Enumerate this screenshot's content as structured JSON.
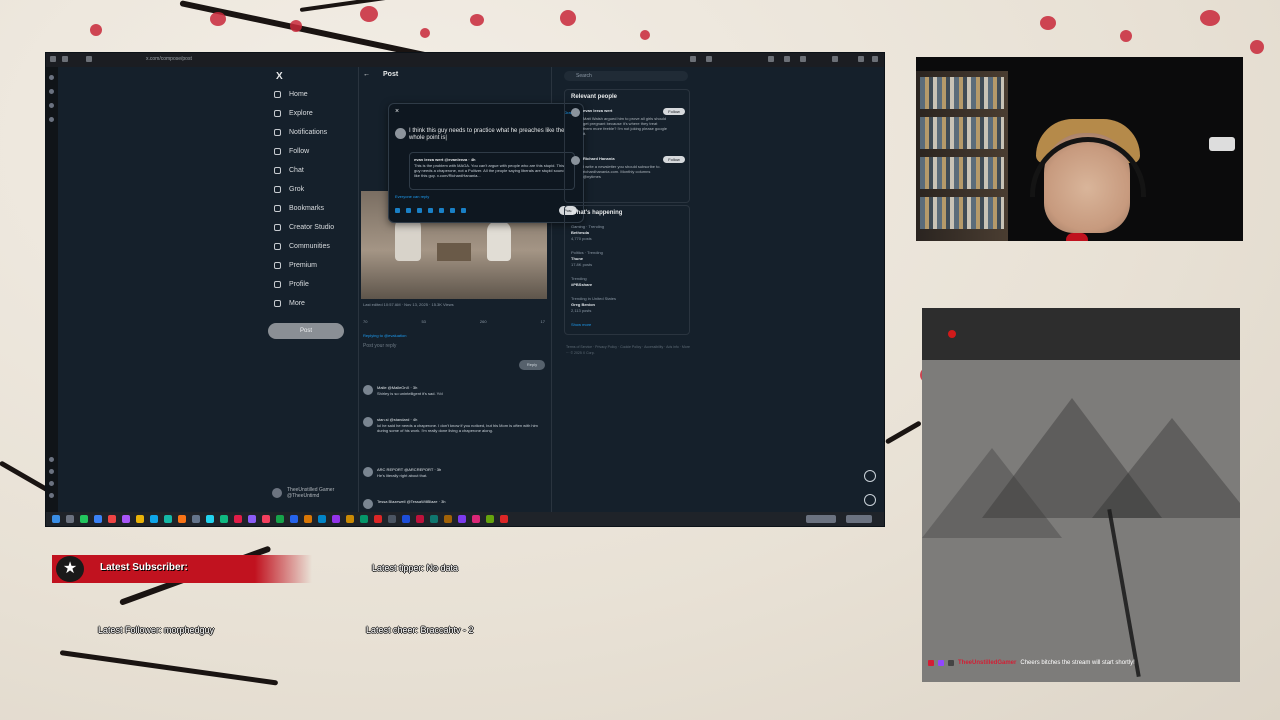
{
  "browser": {
    "url": "x.com/compose/post"
  },
  "x_nav": {
    "logo": "X",
    "items": [
      {
        "label": "Home",
        "icon": "home-icon"
      },
      {
        "label": "Explore",
        "icon": "search-icon"
      },
      {
        "label": "Notifications",
        "icon": "bell-icon"
      },
      {
        "label": "Follow",
        "icon": "person-plus-icon"
      },
      {
        "label": "Chat",
        "icon": "chat-icon"
      },
      {
        "label": "Grok",
        "icon": "grok-icon"
      },
      {
        "label": "Bookmarks",
        "icon": "bookmark-icon"
      },
      {
        "label": "Creator Studio",
        "icon": "studio-icon"
      },
      {
        "label": "Communities",
        "icon": "communities-icon"
      },
      {
        "label": "Premium",
        "icon": "x-premium-icon"
      },
      {
        "label": "Profile",
        "icon": "profile-icon"
      },
      {
        "label": "More",
        "icon": "more-icon"
      }
    ],
    "post_button": "Post",
    "account": {
      "name": "TheeUnstilled Gamer",
      "handle": "@TheeUntimd"
    }
  },
  "center": {
    "back": "←",
    "title": "Post",
    "meta": "Last edited 10:57 AM · Nov 13, 2025 · 15.3K Views",
    "metrics": [
      "70",
      "53",
      "260",
      "17"
    ],
    "replying_to": "Replying to @evaluation",
    "reply_placeholder": "Post your reply",
    "reply_button": "Reply",
    "replies": [
      {
        "who": "Malle @MalleOnX · 3h",
        "text": "Shirley is so unintelligent it's sad. Y/d"
      },
      {
        "who": "stan.si @standard · 4h",
        "text": "lol he said he needs a chaperone. I don't know if you noticed, but his Mom is often with him during some of his work. I'm really done living a chaperone along."
      },
      {
        "who": "ARC REPORT @ARCREPORT · 3h",
        "text": "He's literally right about that."
      },
      {
        "who": "Tessa Blazewell @TessaWillBlaze · 3h",
        "text": ""
      }
    ]
  },
  "compose": {
    "close": "×",
    "drafts": "Drafts",
    "draft_text": "I think this guy needs to practice what he preaches like the whole point is|",
    "quote_author": "evan leeza wert @evanleeza · 4h",
    "quote_text": "This is the problem with MAGA. You can't argue with people who are this stupid. This guy needs a chaperone, not a Pulitzer. All the people saying liberals are stupid sound like this guy. x.com/RichardHanania...",
    "reply_setting": "Everyone can reply",
    "post_label": "Post"
  },
  "right": {
    "search_placeholder": "Search",
    "relevant_title": "Relevant people",
    "people": [
      {
        "name": "evan leeza wert",
        "bio": "Matt Walsh argued him to prove all girls should get pregnant because it's where they treat them more feeble? I'm not joking please google it.",
        "follow": "Follow"
      },
      {
        "name": "Richard Hanania",
        "bio": "I write a newsletter you should subscribe to. richardhanania.com. Monthly columns @nytimes",
        "follow": "Follow"
      }
    ],
    "happening_title": "What's happening",
    "trends": [
      {
        "context": "Gaming · Trending",
        "name": "Bethesda",
        "count": "4,770 posts"
      },
      {
        "context": "Politics · Trending",
        "name": "Thune",
        "count": "17.8K posts"
      },
      {
        "context": "Trending",
        "name": "#PBSshare",
        "count": ""
      },
      {
        "context": "Trending in United States",
        "name": "Greg Benion",
        "count": "2,113 posts"
      }
    ],
    "show_more": "Show more",
    "footer": "Terms of Service · Privacy Policy · Cookie Policy · Accessibility · Ads info · More ··· © 2025 X Corp."
  },
  "overlay": {
    "subscriber_label": "Latest Subscriber:",
    "tipper": "Latest tipper: No data",
    "follower": "Latest Follower: morphedguy",
    "cheer": "Latest cheer: Braccahtv - 2",
    "chat_user": "TheeUnstilledGamer",
    "chat_message": "Cheers bitches the stream will start shortly!"
  },
  "colors": {
    "accent_red": "#c1121f",
    "x_blue": "#1d9bf0",
    "x_bg": "#15202b"
  }
}
